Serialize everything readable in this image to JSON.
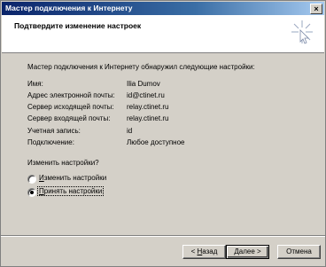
{
  "window": {
    "title": "Мастер подключения к Интернету",
    "close_label": "×"
  },
  "header": {
    "heading": "Подтвердите изменение настроек"
  },
  "content": {
    "intro": "Мастер подключения к Интернету обнаружил следующие настройки:",
    "settings": [
      {
        "label": "Имя:",
        "value": "Ilia Dumov"
      },
      {
        "label": "Адрес электронной почты:",
        "value": "id@ctinet.ru"
      },
      {
        "label": "Сервер исходящей почты:",
        "value": "relay.ctinet.ru"
      },
      {
        "label": "Сервер входящей почты:",
        "value": "relay.ctinet.ru"
      },
      {
        "label": "Учетная запись:",
        "value": "id"
      },
      {
        "label": "Подключение:",
        "value": "Любое доступное"
      }
    ],
    "question": "Изменить настройки?",
    "options": [
      {
        "label_accel": "И",
        "label_rest": "зменить настройки",
        "selected": false
      },
      {
        "label_accel": "П",
        "label_rest": "ринять настройки",
        "selected": true
      }
    ]
  },
  "buttons": {
    "back_prefix": "< ",
    "back_accel": "Н",
    "back_rest": "азад",
    "next": "Далее >",
    "cancel": "Отмена"
  }
}
